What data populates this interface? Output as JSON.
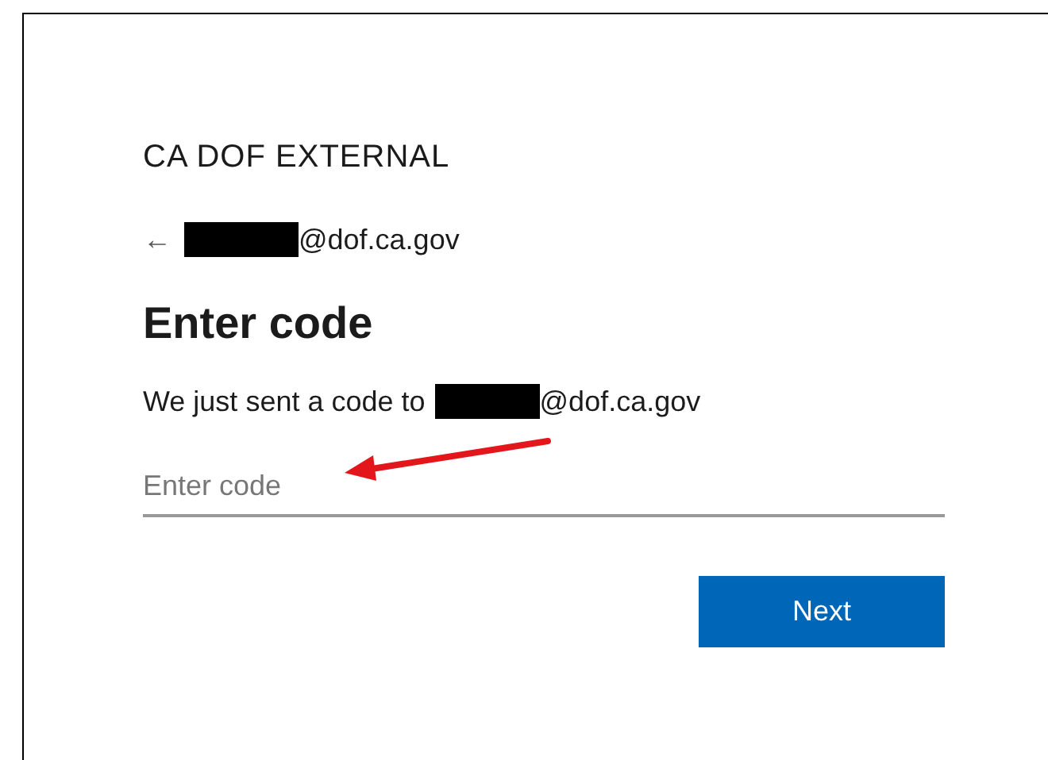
{
  "brand": "CA DOF EXTERNAL",
  "identity": {
    "back": "←",
    "email_suffix": "@dof.ca.gov"
  },
  "heading": "Enter code",
  "message": {
    "text": "We just sent a code to",
    "email_suffix": "@dof.ca.gov"
  },
  "code_field": {
    "placeholder": "Enter code"
  },
  "next_button": {
    "label": "Next"
  }
}
